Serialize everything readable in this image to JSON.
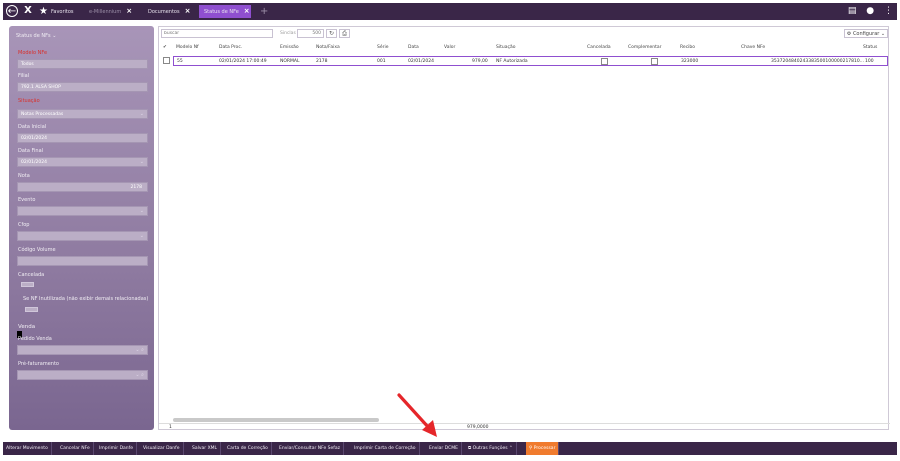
{
  "tabs": {
    "favorites": "Favoritos",
    "milenium": "e-Millennium",
    "documents": "Documentos",
    "status": "Status de NFe",
    "add": "+"
  },
  "sidebar": {
    "title": "Status de NFs",
    "modelo_label": "Modelo NFe",
    "modelo_value": "Todos",
    "filial_label": "Filial",
    "filial_value": "792.1 ALSA SHOP",
    "situacao_label": "Situação",
    "situacao_value": "Notas Processadas",
    "data_inicial_label": "Data Inicial",
    "data_inicial_value": "02/01/2024",
    "data_final_label": "Data Final",
    "data_final_value": "02/01/2024",
    "nota_label": "Nota",
    "nota_value": "2178",
    "evento_label": "Evento",
    "cfop_label": "Cfop",
    "codigo_volume_label": "Código Volume",
    "cancelada_label": "Cancelada",
    "inutilizada_label": "Se NF Inutilizada (não exibir demais relacionadas)",
    "venda_label": "Venda",
    "pedido_venda_label": "Pedido Venda",
    "pre_faturamento_label": "Pré-faturamento"
  },
  "toolbar": {
    "search_placeholder": "buscar",
    "sinc_label": "Sinclas",
    "sinc_value": "500",
    "config_label": "Configurar"
  },
  "grid": {
    "headers": [
      "Modelo Nf",
      "Data Proc.",
      "Emissão",
      "Nota/Faixa",
      "Série",
      "Data",
      "Valor",
      "Situação",
      "Cancelada",
      "Complementar",
      "Recibo",
      "Chave NFe",
      "Status"
    ],
    "row": {
      "modelo": "55",
      "data_proc": "02/01/2024 17:00:49",
      "emissao": "NORMAL",
      "nota": "2178",
      "serie": "001",
      "data": "02/01/2024",
      "valor": "979,00",
      "situacao": "NF Autorizada",
      "recibo": "323000",
      "chave": "3537204840243383500100000217810...",
      "status": "100"
    },
    "footer_count": "1",
    "footer_total": "979,0000"
  },
  "actions": [
    "Alterar Movimento",
    "Cancelar NFe",
    "Imprimir Danfe",
    "Visualizar Danfe",
    "Salvar XML",
    "Carta de Correção",
    "Enviar/Consultar NFe Sefaz",
    "Imprimir Carta de Correção",
    "Enviar DCME",
    "Outras Funções",
    "Processar"
  ],
  "colors": {
    "bar": "#3a2648",
    "accent": "#8f4fd0",
    "processar": "#f07b2e",
    "arrow": "#e5262a"
  }
}
